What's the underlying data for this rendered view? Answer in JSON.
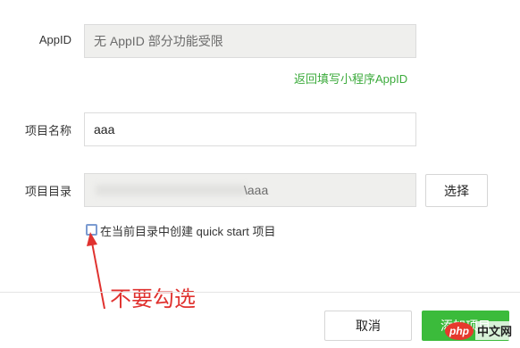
{
  "form": {
    "appid_label": "AppID",
    "appid_value": "无 AppID 部分功能受限",
    "appid_link": "返回填写小程序AppID",
    "name_label": "项目名称",
    "name_value": "aaa",
    "dir_label": "项目目录",
    "dir_value": "\\aaa",
    "choose_button": "选择",
    "quickstart_label": "在当前目录中创建 quick start 项目",
    "quickstart_checked": false
  },
  "footer": {
    "cancel_button": "取消",
    "add_button": "添加项目"
  },
  "annotation": {
    "text": "不要勾选",
    "color": "#e0322f"
  },
  "watermark": {
    "logo": "php",
    "text": "中文网"
  },
  "colors": {
    "accent_green": "#3bbb3b",
    "link_green": "#3cab3c",
    "disabled_bg": "#efefed"
  }
}
